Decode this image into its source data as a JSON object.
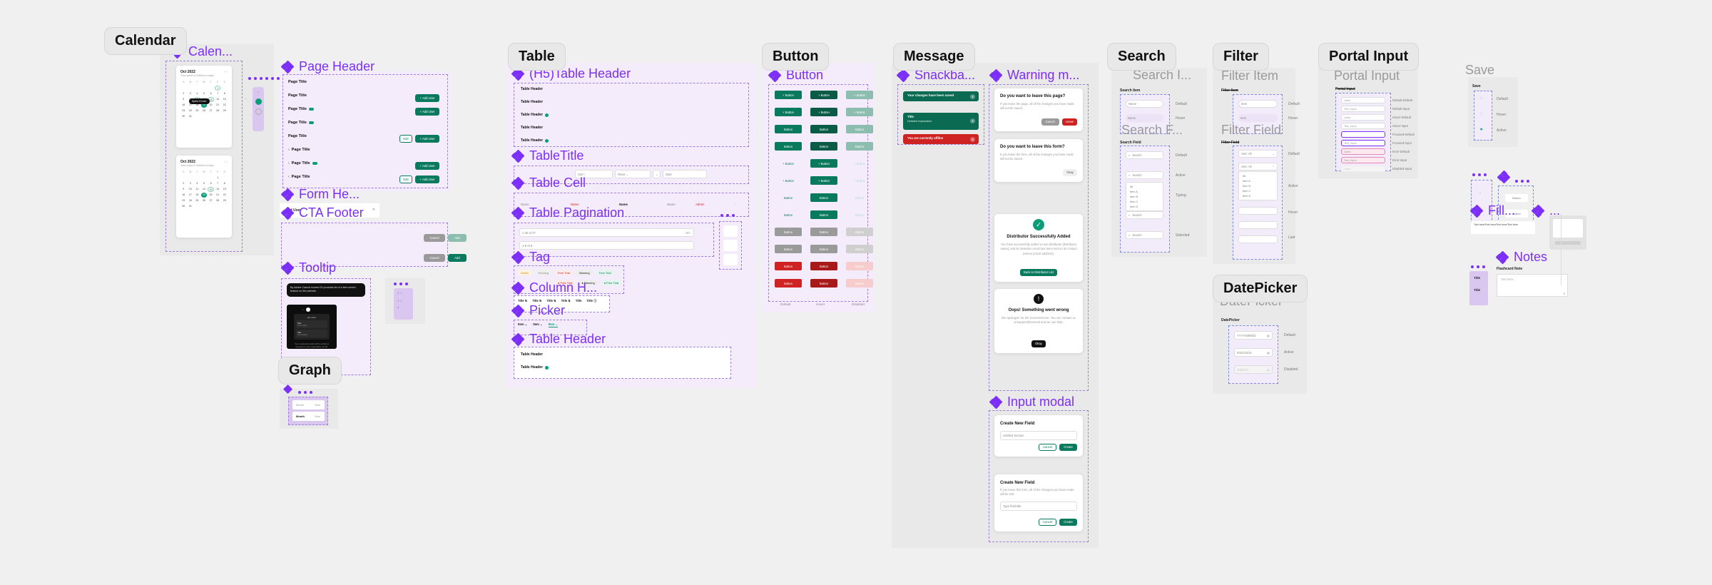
{
  "canvas": {
    "background": "#f0f0f0",
    "accent": "#7b2ff7",
    "green": "#0a7a5e",
    "red": "#cf2222"
  },
  "sections": [
    {
      "id": "calendar",
      "chip": "Calendar",
      "title": "Calen..."
    },
    {
      "id": "pageheader",
      "chip": "",
      "title": "Page Header"
    },
    {
      "id": "table",
      "chip": "Table",
      "title": "(H5)Table Header"
    },
    {
      "id": "button",
      "chip": "Button",
      "title": "Button"
    },
    {
      "id": "message",
      "chip": "Message",
      "title": "Snackba..."
    },
    {
      "id": "warning",
      "chip": "",
      "title": "Warning m..."
    },
    {
      "id": "search",
      "chip": "Search",
      "title": "Search I..."
    },
    {
      "id": "filter",
      "chip": "Filter",
      "title": "Filter Item"
    },
    {
      "id": "portal",
      "chip": "Portal Input",
      "title": "Portal Input"
    },
    {
      "id": "datepicker",
      "chip": "DatePicker",
      "title": "DatePicker"
    },
    {
      "id": "graph",
      "chip": "Graph",
      "title": ""
    }
  ],
  "calendar": {
    "chip": "Calendar",
    "title": "Calen...",
    "cards": [
      {
        "month": "Oct 2022",
        "sub": "Time point in Oct/Nov is days",
        "weekdays": [
          "S",
          "M",
          "T",
          "W",
          "T",
          "F",
          "S"
        ],
        "tooltip": "Spent 10 min.",
        "weeks": [
          [
            "",
            "",
            "",
            "",
            "",
            "1",
            ""
          ],
          [
            "2",
            "3",
            "4",
            "5",
            "6",
            "7",
            "8"
          ],
          [
            "9",
            "10",
            "11",
            "12",
            "13",
            "14",
            "15"
          ],
          [
            "16",
            "17",
            "18",
            "19",
            "20",
            "21",
            "22"
          ],
          [
            "23",
            "24",
            "25",
            "26",
            "27",
            "28",
            "29"
          ],
          [
            "30",
            "31",
            "",
            "",
            "",
            "",
            ""
          ]
        ],
        "selected": "19",
        "ringed": [
          "1",
          "11",
          "13"
        ]
      },
      {
        "month": "Oct 2022",
        "sub": "Time point in Oct/Nov is days",
        "weekdays": [
          "S",
          "M",
          "T",
          "W",
          "T",
          "F",
          "S"
        ],
        "weeks": [
          [
            "",
            "",
            "",
            "",
            "",
            "1",
            ""
          ],
          [
            "2",
            "3",
            "4",
            "5",
            "6",
            "7",
            "8"
          ],
          [
            "9",
            "10",
            "11",
            "12",
            "13",
            "14",
            "15"
          ],
          [
            "16",
            "17",
            "18",
            "19",
            "20",
            "21",
            "22"
          ],
          [
            "23",
            "24",
            "25",
            "26",
            "27",
            "28",
            "29"
          ],
          [
            "30",
            "31",
            "",
            "",
            "",
            "",
            ""
          ]
        ],
        "selected": "19",
        "ringed": [
          "13"
        ]
      }
    ],
    "side_steps": [
      "‹",
      "●",
      "○"
    ]
  },
  "page_header": {
    "title": "Page Header",
    "rows": [
      {
        "label": "Page Title",
        "badge": false,
        "back": false,
        "buttons": []
      },
      {
        "label": "Page Title",
        "badge": false,
        "back": false,
        "buttons": [
          "+ Add User"
        ]
      },
      {
        "label": "Page Title",
        "badge": true,
        "back": false,
        "buttons": [
          "+ Add User"
        ]
      },
      {
        "label": "Page Title",
        "badge": true,
        "back": false,
        "buttons": []
      },
      {
        "label": "Page Title",
        "badge": false,
        "back": false,
        "buttons": [
          "Edit",
          "+ Add User"
        ]
      },
      {
        "label": "Page Title",
        "badge": false,
        "back": true,
        "buttons": []
      },
      {
        "label": "Page Title",
        "badge": true,
        "back": true,
        "buttons": [
          "+ Add User"
        ]
      },
      {
        "label": "Page Title",
        "badge": false,
        "back": true,
        "buttons": [
          "Edit",
          "+ Add User"
        ]
      }
    ]
  },
  "form_header": {
    "title": "Form He...",
    "label": "Add User"
  },
  "cta_footer": {
    "title": "CTA Footer",
    "rows": [
      {
        "cancel": "Cancel",
        "confirm": "Add",
        "disabled": true
      },
      {
        "cancel": "Cancel",
        "confirm": "Add",
        "disabled": false
      }
    ]
  },
  "tooltip": {
    "title": "Tooltip",
    "text": "By Adobe Cannot exceed 20 products list of a item sorted feature on this website.",
    "dark_card_caption": "Your customized order will be visible to everyone in your organization at VM.",
    "dark_card_menu_rows": [
      {
        "t": "Title",
        "s": "Sub-heading"
      },
      {
        "t": "Title",
        "s": "Sub-heading"
      }
    ],
    "dark_card_header": "job order"
  },
  "graph": {
    "chip": "Graph",
    "rows": [
      {
        "left": "Month",
        "right": "Year",
        "active": false
      },
      {
        "left": "Month",
        "right": "Year",
        "active": true
      }
    ]
  },
  "table": {
    "chip": "Table",
    "header_title": "(H5)Table Header",
    "header_rows": [
      {
        "label": "Table Header",
        "icon": false
      },
      {
        "label": "Table Header",
        "icon": false
      },
      {
        "label": "Table Header",
        "icon": true
      },
      {
        "label": "Table Header",
        "icon": false
      },
      {
        "label": "Table Header",
        "icon": true
      }
    ],
    "table_title": "TableTitle",
    "table_title_fields": [
      "Sort  ↑",
      "Rows   ⌄",
      "⌄",
      "Date"
    ],
    "table_cell_title": "Table Cell",
    "table_cell_values": [
      "Name",
      "Name",
      "Name",
      "Name",
      "Admin",
      "⋮"
    ],
    "pagination_title": "Table Pagination",
    "pagination_rows": [
      "1-20 of 27",
      "1-8 of 8"
    ],
    "pagination_controls": [
      "‹",
      "50",
      "›"
    ],
    "pagination_side": [
      "#",
      "#",
      ""
    ],
    "tag_title": "Tag",
    "tags_row1": [
      {
        "label": "Admin",
        "color": "#d98b12",
        "bg": "#fdf3e2"
      },
      {
        "label": "Working",
        "color": "#8b8b8b",
        "bg": "#f0f0f0"
      },
      {
        "label": "Free Trial",
        "color": "#cf2222",
        "bg": "#fdecec"
      },
      {
        "label": "Warning",
        "color": "#222222",
        "bg": "#ededed"
      },
      {
        "label": "Free Trial",
        "color": "#0a7a5e",
        "bg": "#e6f4ef"
      }
    ],
    "tags_row2": [
      {
        "label": "● Free Trial",
        "color": "#cf2222",
        "bg": "#fdecec"
      },
      {
        "label": "● Warning",
        "color": "#222222",
        "bg": "#ededed"
      },
      {
        "label": "● Free Trial",
        "color": "#0a7a5e",
        "bg": "#e6f4ef"
      }
    ],
    "column_header_title": "Column H...",
    "column_header_items": [
      "Title ⇅",
      "Title ⇅",
      "Title ⇅",
      "Title ⇅",
      "Title",
      "Title ⓘ"
    ],
    "picker_title": "Picker",
    "picker_items": [
      "Item  ⌄",
      "Item  ⌄",
      "Item  ⌄"
    ],
    "footer_title": "Table Header",
    "footer_rows": [
      {
        "label": "Table Header",
        "icon": false
      },
      {
        "label": "Table Header",
        "icon": true
      }
    ]
  },
  "button": {
    "chip": "Button",
    "title": "Button",
    "col_labels": [
      "Default",
      "Hover",
      "Disabled"
    ],
    "rows": [
      {
        "label": "+ Button",
        "variants": [
          "g",
          "gd",
          "gl"
        ]
      },
      {
        "label": "+ Button",
        "variants": [
          "g",
          "gd",
          "gl"
        ]
      },
      {
        "label": "Button",
        "variants": [
          "g",
          "gd",
          "gl"
        ]
      },
      {
        "label": "Button",
        "variants": [
          "g",
          "gd",
          "gl"
        ]
      },
      {
        "label": "+ Button",
        "variants": [
          "ghost-flat",
          "g",
          "pale-flat"
        ]
      },
      {
        "label": "+ Button",
        "variants": [
          "ghost-flat",
          "g",
          "pale-flat"
        ]
      },
      {
        "label": "Button",
        "variants": [
          "ghost-flat",
          "g",
          "pale-flat"
        ]
      },
      {
        "label": "Button",
        "variants": [
          "ghost-flat",
          "g",
          "pale-flat"
        ]
      },
      {
        "label": "Button",
        "variants": [
          "gray2",
          "gray2",
          "graylt"
        ]
      },
      {
        "label": "Button",
        "variants": [
          "gray2",
          "gray2",
          "graylt"
        ]
      },
      {
        "label": "Button",
        "variants": [
          "red",
          "reddk",
          "redlt"
        ]
      },
      {
        "label": "Button",
        "variants": [
          "red",
          "reddk",
          "redlt"
        ]
      }
    ]
  },
  "message": {
    "chip": "Message",
    "title": "Snackba...",
    "snackbars": [
      {
        "text": "Your changes have been saved",
        "sub": "",
        "type": "green"
      },
      {
        "text": "Title",
        "sub": "Detailed explanation",
        "type": "green"
      },
      {
        "text": "You are currently offline",
        "sub": "",
        "type": "red"
      }
    ]
  },
  "warning": {
    "title": "Warning m...",
    "modals": [
      {
        "title": "Do you want to leave this page?",
        "text": "If you leave the page, all of the changes you have made will not be saved.",
        "cancel": "Cancel",
        "confirm": "Leave",
        "confirm_color": "#cf2222"
      },
      {
        "title": "Do you want to leave this form?",
        "text": "If you leave the form, all of the changes you have made will not be saved.",
        "cancel": "",
        "confirm": "Okay",
        "confirm_color": "#f0f0f0"
      },
      {
        "title": "Distributor Successfully Added",
        "text": "You have successfully added a new distributor [distributor name], and its invitation email has been sent to its contact person [email address].",
        "cancel": "",
        "confirm": "Back to Distributor List",
        "confirm_color": "#0a7a5e",
        "icon": "check"
      },
      {
        "title": "Oops! Something went wrong",
        "text": "We apologize for the inconvenience. You can contact us at support@internal and we can help.",
        "cancel": "",
        "confirm": "Okay",
        "confirm_color": "#111111",
        "icon": "exclaim"
      }
    ]
  },
  "input_modal": {
    "title": "Input modal",
    "modals": [
      {
        "title": "Create New Field",
        "desc": "",
        "field": "Untitled Section",
        "cancel": "Cancel",
        "confirm": "Create"
      },
      {
        "title": "Create New Field",
        "desc": "If you leave this form, all of the changes you have made will be lost.",
        "field": "Type field title",
        "cancel": "Cancel",
        "confirm": "Create"
      }
    ]
  },
  "search": {
    "chip": "Search",
    "item_title": "Search I...",
    "item_label": "Search Item",
    "item_rows": [
      {
        "value": "Name",
        "state": "Default"
      },
      {
        "value": "Name",
        "state": "Hover"
      }
    ],
    "field_title": "Search F...",
    "field_label": "Search Field",
    "field_rows": [
      {
        "value": "Search",
        "state": "Default"
      },
      {
        "value": "Search",
        "state": "Active"
      },
      {
        "value": "Search",
        "state": "Typing"
      },
      {
        "value": "Search",
        "state": ""
      },
      {
        "value": "Search",
        "state": "Selected"
      }
    ],
    "dropdown_items": [
      "All",
      "Item A",
      "Item B",
      "Item C",
      "Item D"
    ]
  },
  "filter": {
    "chip": "Filter",
    "item_title": "Filter Item",
    "item_label": "Filter Item",
    "item_rows": [
      {
        "value": "Item",
        "state": "Default"
      },
      {
        "value": "Item",
        "state": "Hover"
      }
    ],
    "field_title": "Filter Field",
    "field_label": "Filter Field",
    "field_rows": [
      {
        "value": "Sort: All",
        "state": "Default"
      },
      {
        "value": "Sort: All",
        "state": "Active"
      }
    ],
    "dropdown_items": [
      "All",
      "Item A",
      "Item B",
      "Item C",
      "Item D"
    ],
    "state_labels": [
      "Default",
      "Active",
      "Hover",
      "Last"
    ]
  },
  "portal": {
    "chip": "Portal Input",
    "title": "Portal Input",
    "label": "Portal Input",
    "rows": [
      {
        "value": "Label",
        "state": "Default-Default",
        "style": "normal"
      },
      {
        "value": "Text_Input",
        "state": "Default-Input",
        "style": "normal"
      },
      {
        "value": "Label",
        "state": "Hover-Default",
        "style": "normal"
      },
      {
        "value": "Text_Input",
        "state": "Hover-Input",
        "style": "normal"
      },
      {
        "value": "",
        "state": "Focused-Default",
        "style": "focus"
      },
      {
        "value": "Text_Input",
        "state": "Focused-Input",
        "style": "focus"
      },
      {
        "value": "Label",
        "state": "Error-Default",
        "style": "error"
      },
      {
        "value": "Text_Input",
        "state": "Error-Input",
        "style": "error"
      },
      {
        "value": "Label",
        "state": "Disabled-Input",
        "style": "disabled"
      }
    ]
  },
  "datepicker": {
    "chip": "DatePicker",
    "title": "DatePicker",
    "label": "DatePicker",
    "rows": [
      {
        "value": "YYYY/MM/DD",
        "state": "Default"
      },
      {
        "value": "2022/10/31",
        "state": "Active"
      },
      {
        "value": "2022/1/1",
        "state": "Disabled"
      }
    ]
  },
  "save": {
    "title": "Save",
    "label": "Save",
    "rows": [
      {
        "icon": "☆",
        "state": "Default"
      },
      {
        "icon": "☆",
        "state": "Hover"
      },
      {
        "icon": "★",
        "state": "Active"
      }
    ]
  },
  "misc_right": {
    "fill_title": "Fill...",
    "fill_text": "Text here/Text  here/Text here/Text here",
    "dots_title": "...",
    "buttons": [
      "Button",
      "Button"
    ],
    "arrows": [
      "‹",
      "›"
    ],
    "notes_title": "Notes",
    "notes_label": "Flashcard Note",
    "notes_placeholder": "Text here...",
    "tile_title": "Title",
    "tile_title2": "Title"
  }
}
